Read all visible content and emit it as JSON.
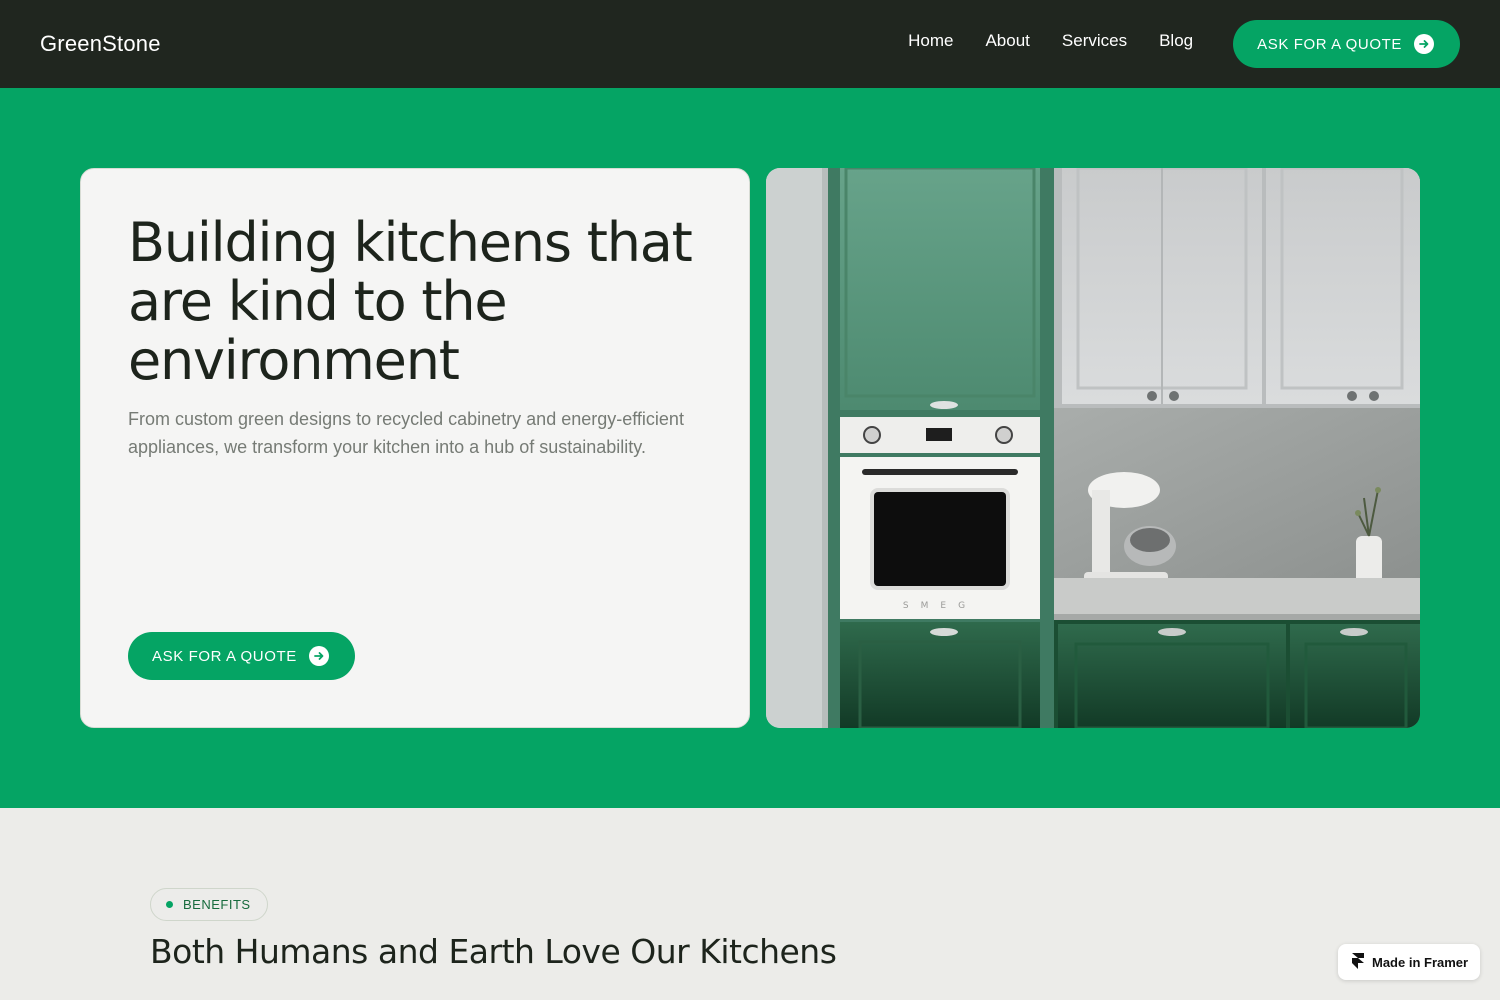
{
  "brand": {
    "name": "GreenStone",
    "accent_color": "#05a464",
    "nav_background": "#20261f"
  },
  "nav": {
    "links": [
      {
        "label": "Home"
      },
      {
        "label": "About"
      },
      {
        "label": "Services"
      },
      {
        "label": "Blog"
      }
    ],
    "cta_label": "ASK FOR A QUOTE",
    "cta_icon": "arrow-right-circle-icon"
  },
  "hero": {
    "title": "Building kitchens that are kind to the environment",
    "subtitle": "From custom green designs to recycled cabinetry and energy-efficient appliances, we transform your kitchen into a hub of sustainability.",
    "cta_label": "ASK FOR A QUOTE",
    "cta_icon": "arrow-right-circle-icon",
    "image_brand_text": "SMEG"
  },
  "benefits": {
    "pill_label": "BENEFITS",
    "title": "Both Humans and Earth Love Our Kitchens"
  },
  "badge": {
    "label": "Made in Framer",
    "icon": "framer-logo-icon"
  }
}
